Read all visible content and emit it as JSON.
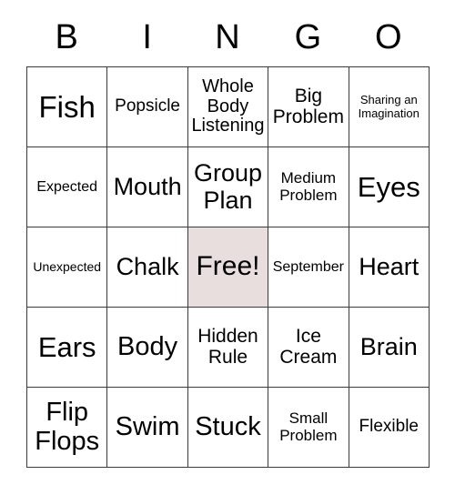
{
  "card": {
    "headers": [
      "B",
      "I",
      "N",
      "G",
      "O"
    ],
    "free_space_color": "#e8dedd",
    "border_color": "#3b3b3b",
    "rows": [
      [
        {
          "label": "Fish",
          "size": "fs-33",
          "free": false
        },
        {
          "label": "Popsicle",
          "size": "fs-19",
          "free": false
        },
        {
          "label": "Whole\nBody\nListening",
          "size": "fs-20",
          "free": false
        },
        {
          "label": "Big\nProblem",
          "size": "fs-21",
          "free": false
        },
        {
          "label": "Sharing an\nImagination",
          "size": "fs-13",
          "free": false
        }
      ],
      [
        {
          "label": "Expected",
          "size": "fs-16",
          "free": false
        },
        {
          "label": "Mouth",
          "size": "fs-27",
          "free": false
        },
        {
          "label": "Group\nPlan",
          "size": "fs-27",
          "free": false
        },
        {
          "label": "Medium\nProblem",
          "size": "fs-17",
          "free": false
        },
        {
          "label": "Eyes",
          "size": "fs-31",
          "free": false
        }
      ],
      [
        {
          "label": "Unexpected",
          "size": "fs-14",
          "free": false
        },
        {
          "label": "Chalk",
          "size": "fs-27",
          "free": false
        },
        {
          "label": "Free!",
          "size": "fs-30",
          "free": true
        },
        {
          "label": "September",
          "size": "fs-16",
          "free": false
        },
        {
          "label": "Heart",
          "size": "fs-27",
          "free": false
        }
      ],
      [
        {
          "label": "Ears",
          "size": "fs-31",
          "free": false
        },
        {
          "label": "Body",
          "size": "fs-29",
          "free": false
        },
        {
          "label": "Hidden\nRule",
          "size": "fs-21",
          "free": false
        },
        {
          "label": "Ice\nCream",
          "size": "fs-21",
          "free": false
        },
        {
          "label": "Brain",
          "size": "fs-27",
          "free": false
        }
      ],
      [
        {
          "label": "Flip\nFlops",
          "size": "fs-29",
          "free": false
        },
        {
          "label": "Swim",
          "size": "fs-29",
          "free": false
        },
        {
          "label": "Stuck",
          "size": "fs-29",
          "free": false
        },
        {
          "label": "Small\nProblem",
          "size": "fs-17",
          "free": false
        },
        {
          "label": "Flexible",
          "size": "fs-19",
          "free": false
        }
      ]
    ]
  }
}
